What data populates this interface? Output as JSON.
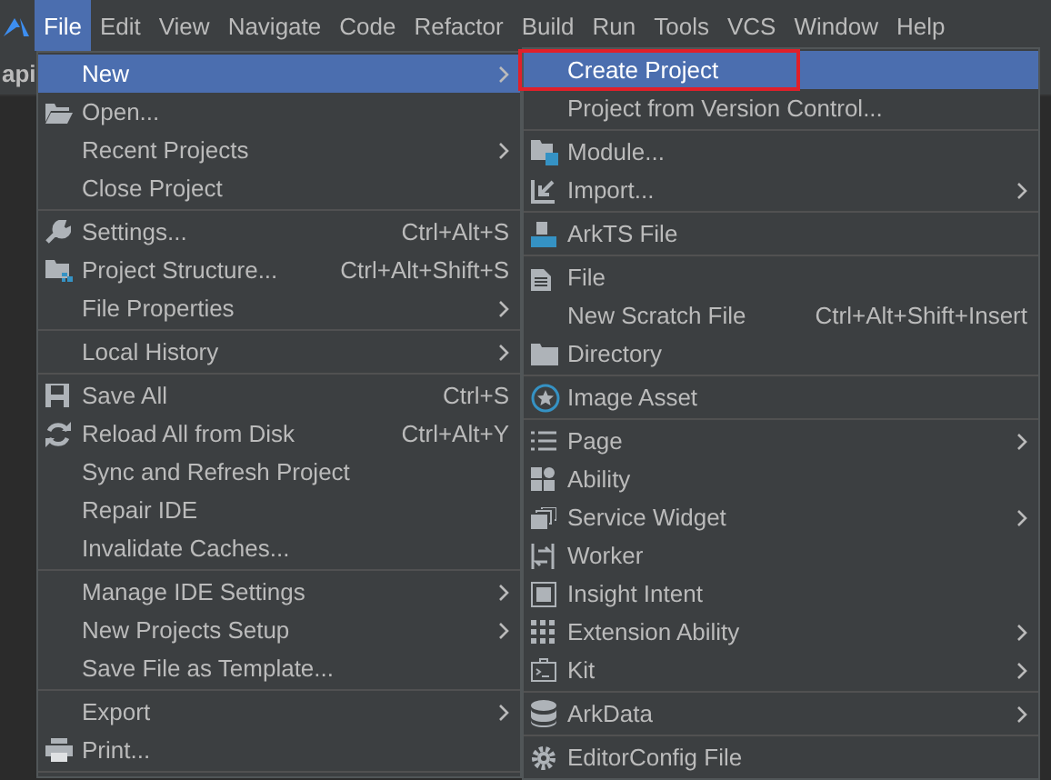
{
  "menubar": [
    {
      "label": "File",
      "selected": true
    },
    {
      "label": "Edit",
      "selected": false
    },
    {
      "label": "View",
      "selected": false
    },
    {
      "label": "Navigate",
      "selected": false
    },
    {
      "label": "Code",
      "selected": false
    },
    {
      "label": "Refactor",
      "selected": false
    },
    {
      "label": "Build",
      "selected": false
    },
    {
      "label": "Run",
      "selected": false
    },
    {
      "label": "Tools",
      "selected": false
    },
    {
      "label": "VCS",
      "selected": false
    },
    {
      "label": "Window",
      "selected": false
    },
    {
      "label": "Help",
      "selected": false
    }
  ],
  "background": {
    "project_tab": "api"
  },
  "file_menu": [
    {
      "kind": "item",
      "label": "New",
      "submenu": true,
      "selected": true
    },
    {
      "kind": "item",
      "label": "Open...",
      "selected": false
    },
    {
      "kind": "item",
      "label": "Recent Projects",
      "submenu": true,
      "selected": false
    },
    {
      "kind": "item",
      "label": "Close Project",
      "selected": false
    },
    {
      "kind": "separator"
    },
    {
      "kind": "item",
      "label": "Settings...",
      "shortcut": "Ctrl+Alt+S",
      "selected": false
    },
    {
      "kind": "item",
      "label": "Project Structure...",
      "shortcut": "Ctrl+Alt+Shift+S",
      "selected": false
    },
    {
      "kind": "item",
      "label": "File Properties",
      "submenu": true,
      "selected": false
    },
    {
      "kind": "separator"
    },
    {
      "kind": "item",
      "label": "Local History",
      "submenu": true,
      "selected": false
    },
    {
      "kind": "separator"
    },
    {
      "kind": "item",
      "label": "Save All",
      "shortcut": "Ctrl+S",
      "selected": false
    },
    {
      "kind": "item",
      "label": "Reload All from Disk",
      "shortcut": "Ctrl+Alt+Y",
      "selected": false
    },
    {
      "kind": "item",
      "label": "Sync and Refresh Project",
      "selected": false
    },
    {
      "kind": "item",
      "label": "Repair IDE",
      "selected": false
    },
    {
      "kind": "item",
      "label": "Invalidate Caches...",
      "selected": false
    },
    {
      "kind": "separator"
    },
    {
      "kind": "item",
      "label": "Manage IDE Settings",
      "submenu": true,
      "selected": false
    },
    {
      "kind": "item",
      "label": "New Projects Setup",
      "submenu": true,
      "selected": false
    },
    {
      "kind": "item",
      "label": "Save File as Template...",
      "selected": false
    },
    {
      "kind": "separator"
    },
    {
      "kind": "item",
      "label": "Export",
      "submenu": true,
      "selected": false
    },
    {
      "kind": "item",
      "label": "Print...",
      "selected": false
    },
    {
      "kind": "separator"
    }
  ],
  "new_submenu": [
    {
      "kind": "item",
      "label": "Create Project",
      "selected": true,
      "outlined": true
    },
    {
      "kind": "item",
      "label": "Project from Version Control...",
      "selected": false
    },
    {
      "kind": "separator"
    },
    {
      "kind": "item",
      "label": "Module...",
      "selected": false
    },
    {
      "kind": "item",
      "label": "Import...",
      "submenu": true,
      "selected": false
    },
    {
      "kind": "separator"
    },
    {
      "kind": "item",
      "label": "ArkTS File",
      "selected": false
    },
    {
      "kind": "separator"
    },
    {
      "kind": "item",
      "label": "File",
      "selected": false
    },
    {
      "kind": "item",
      "label": "New Scratch File",
      "shortcut": "Ctrl+Alt+Shift+Insert",
      "selected": false
    },
    {
      "kind": "item",
      "label": "Directory",
      "selected": false
    },
    {
      "kind": "separator"
    },
    {
      "kind": "item",
      "label": "Image Asset",
      "selected": false
    },
    {
      "kind": "separator"
    },
    {
      "kind": "item",
      "label": "Page",
      "submenu": true,
      "selected": false
    },
    {
      "kind": "item",
      "label": "Ability",
      "selected": false
    },
    {
      "kind": "item",
      "label": "Service Widget",
      "submenu": true,
      "selected": false
    },
    {
      "kind": "item",
      "label": "Worker",
      "selected": false
    },
    {
      "kind": "item",
      "label": "Insight Intent",
      "selected": false
    },
    {
      "kind": "item",
      "label": "Extension Ability",
      "submenu": true,
      "selected": false
    },
    {
      "kind": "item",
      "label": "Kit",
      "submenu": true,
      "selected": false
    },
    {
      "kind": "separator"
    },
    {
      "kind": "item",
      "label": "ArkData",
      "submenu": true,
      "selected": false
    },
    {
      "kind": "separator"
    },
    {
      "kind": "item",
      "label": "EditorConfig File",
      "selected": false
    }
  ]
}
